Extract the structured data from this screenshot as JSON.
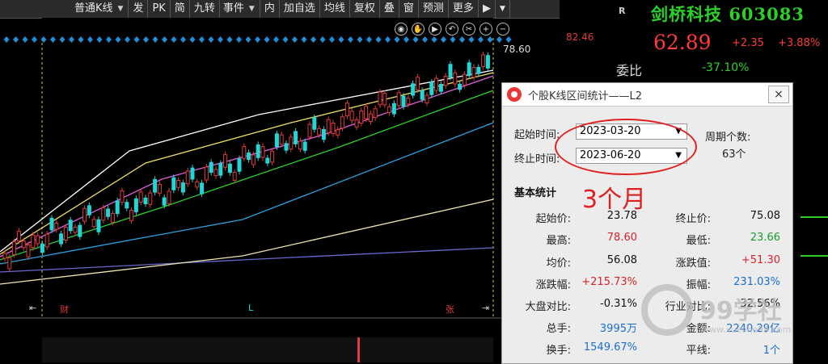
{
  "toolbar": {
    "items": [
      "普通K线",
      "发",
      "PK",
      "简",
      "九转",
      "事件",
      "内",
      "加自选",
      "均线",
      "复权",
      "叠",
      "窗",
      "预测",
      "更多"
    ],
    "arrow_right": "▶"
  },
  "chart": {
    "type": "candlestick",
    "price_top": "82.46",
    "max_marker": "78.60",
    "bottom_labels": {
      "left": "财",
      "mid": "L",
      "right": "张"
    },
    "icons": [
      "eye-icon",
      "hand-icon",
      "play-icon",
      "undo-icon",
      "scissors-icon",
      "plus-icon",
      "minus-icon"
    ],
    "colors": {
      "up": "#e03a3a",
      "down": "#20d6d6",
      "ma5": "#ffffff",
      "ma10": "#f0e060",
      "ma20": "#e060e0",
      "ma30": "#29d129",
      "ma60": "#2aa0e0",
      "ma120": "#f0e6b0",
      "ma250": "#6a6ad0"
    }
  },
  "right": {
    "mark": "R",
    "stock_name": "剑桥科技",
    "code": "603083",
    "price": "62.89",
    "change": "+2.35",
    "pct": "+3.88%",
    "webi_label": "委比",
    "webi_value": "-37.10%"
  },
  "popup": {
    "title": "个股K线区间统计——L2",
    "close": "×",
    "start_label": "起始时间:",
    "start_value": "2023-03-20",
    "end_label": "终止时间:",
    "end_value": "2023-06-20",
    "period_label": "周期个数:",
    "period_value": "63个",
    "annotation": "3个月",
    "section": "基本统计",
    "stats": {
      "start_price_label": "起始价:",
      "start_price": "23.78",
      "end_price_label": "终止价:",
      "end_price": "75.08",
      "high_label": "最高:",
      "high": "78.60",
      "low_label": "最低:",
      "low": "23.66",
      "avg_label": "均价:",
      "avg": "56.08",
      "chg_label": "涨跌值:",
      "chg": "+51.30",
      "pctchg_label": "涨跌幅:",
      "pctchg": "+215.73%",
      "amp_label": "振幅:",
      "amp": "231.03%",
      "vs_market_label": "大盘对比:",
      "vs_market": "-0.31%",
      "vs_industry_label": "行业对比:",
      "vs_industry": "32.56%",
      "vol_label": "总手:",
      "vol": "3995万",
      "amt_label": "金额:",
      "amt": "2240.29亿",
      "turnover_label": "换手:",
      "turnover": "1549.67%",
      "flat_label": "平线:",
      "flat": "1个"
    }
  },
  "watermark": {
    "text": "99学社",
    "url": "www.xueshe99.com"
  }
}
